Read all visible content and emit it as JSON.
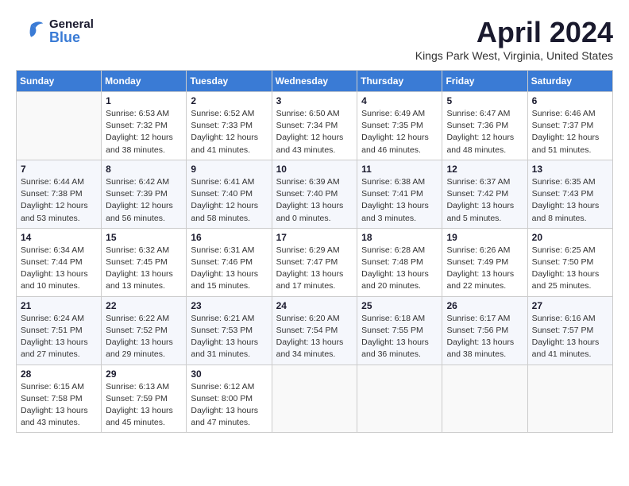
{
  "header": {
    "logo_general": "General",
    "logo_blue": "Blue",
    "month_title": "April 2024",
    "location": "Kings Park West, Virginia, United States"
  },
  "days_of_week": [
    "Sunday",
    "Monday",
    "Tuesday",
    "Wednesday",
    "Thursday",
    "Friday",
    "Saturday"
  ],
  "weeks": [
    [
      {
        "day": "",
        "info": ""
      },
      {
        "day": "1",
        "info": "Sunrise: 6:53 AM\nSunset: 7:32 PM\nDaylight: 12 hours\nand 38 minutes."
      },
      {
        "day": "2",
        "info": "Sunrise: 6:52 AM\nSunset: 7:33 PM\nDaylight: 12 hours\nand 41 minutes."
      },
      {
        "day": "3",
        "info": "Sunrise: 6:50 AM\nSunset: 7:34 PM\nDaylight: 12 hours\nand 43 minutes."
      },
      {
        "day": "4",
        "info": "Sunrise: 6:49 AM\nSunset: 7:35 PM\nDaylight: 12 hours\nand 46 minutes."
      },
      {
        "day": "5",
        "info": "Sunrise: 6:47 AM\nSunset: 7:36 PM\nDaylight: 12 hours\nand 48 minutes."
      },
      {
        "day": "6",
        "info": "Sunrise: 6:46 AM\nSunset: 7:37 PM\nDaylight: 12 hours\nand 51 minutes."
      }
    ],
    [
      {
        "day": "7",
        "info": "Sunrise: 6:44 AM\nSunset: 7:38 PM\nDaylight: 12 hours\nand 53 minutes."
      },
      {
        "day": "8",
        "info": "Sunrise: 6:42 AM\nSunset: 7:39 PM\nDaylight: 12 hours\nand 56 minutes."
      },
      {
        "day": "9",
        "info": "Sunrise: 6:41 AM\nSunset: 7:40 PM\nDaylight: 12 hours\nand 58 minutes."
      },
      {
        "day": "10",
        "info": "Sunrise: 6:39 AM\nSunset: 7:40 PM\nDaylight: 13 hours\nand 0 minutes."
      },
      {
        "day": "11",
        "info": "Sunrise: 6:38 AM\nSunset: 7:41 PM\nDaylight: 13 hours\nand 3 minutes."
      },
      {
        "day": "12",
        "info": "Sunrise: 6:37 AM\nSunset: 7:42 PM\nDaylight: 13 hours\nand 5 minutes."
      },
      {
        "day": "13",
        "info": "Sunrise: 6:35 AM\nSunset: 7:43 PM\nDaylight: 13 hours\nand 8 minutes."
      }
    ],
    [
      {
        "day": "14",
        "info": "Sunrise: 6:34 AM\nSunset: 7:44 PM\nDaylight: 13 hours\nand 10 minutes."
      },
      {
        "day": "15",
        "info": "Sunrise: 6:32 AM\nSunset: 7:45 PM\nDaylight: 13 hours\nand 13 minutes."
      },
      {
        "day": "16",
        "info": "Sunrise: 6:31 AM\nSunset: 7:46 PM\nDaylight: 13 hours\nand 15 minutes."
      },
      {
        "day": "17",
        "info": "Sunrise: 6:29 AM\nSunset: 7:47 PM\nDaylight: 13 hours\nand 17 minutes."
      },
      {
        "day": "18",
        "info": "Sunrise: 6:28 AM\nSunset: 7:48 PM\nDaylight: 13 hours\nand 20 minutes."
      },
      {
        "day": "19",
        "info": "Sunrise: 6:26 AM\nSunset: 7:49 PM\nDaylight: 13 hours\nand 22 minutes."
      },
      {
        "day": "20",
        "info": "Sunrise: 6:25 AM\nSunset: 7:50 PM\nDaylight: 13 hours\nand 25 minutes."
      }
    ],
    [
      {
        "day": "21",
        "info": "Sunrise: 6:24 AM\nSunset: 7:51 PM\nDaylight: 13 hours\nand 27 minutes."
      },
      {
        "day": "22",
        "info": "Sunrise: 6:22 AM\nSunset: 7:52 PM\nDaylight: 13 hours\nand 29 minutes."
      },
      {
        "day": "23",
        "info": "Sunrise: 6:21 AM\nSunset: 7:53 PM\nDaylight: 13 hours\nand 31 minutes."
      },
      {
        "day": "24",
        "info": "Sunrise: 6:20 AM\nSunset: 7:54 PM\nDaylight: 13 hours\nand 34 minutes."
      },
      {
        "day": "25",
        "info": "Sunrise: 6:18 AM\nSunset: 7:55 PM\nDaylight: 13 hours\nand 36 minutes."
      },
      {
        "day": "26",
        "info": "Sunrise: 6:17 AM\nSunset: 7:56 PM\nDaylight: 13 hours\nand 38 minutes."
      },
      {
        "day": "27",
        "info": "Sunrise: 6:16 AM\nSunset: 7:57 PM\nDaylight: 13 hours\nand 41 minutes."
      }
    ],
    [
      {
        "day": "28",
        "info": "Sunrise: 6:15 AM\nSunset: 7:58 PM\nDaylight: 13 hours\nand 43 minutes."
      },
      {
        "day": "29",
        "info": "Sunrise: 6:13 AM\nSunset: 7:59 PM\nDaylight: 13 hours\nand 45 minutes."
      },
      {
        "day": "30",
        "info": "Sunrise: 6:12 AM\nSunset: 8:00 PM\nDaylight: 13 hours\nand 47 minutes."
      },
      {
        "day": "",
        "info": ""
      },
      {
        "day": "",
        "info": ""
      },
      {
        "day": "",
        "info": ""
      },
      {
        "day": "",
        "info": ""
      }
    ]
  ]
}
